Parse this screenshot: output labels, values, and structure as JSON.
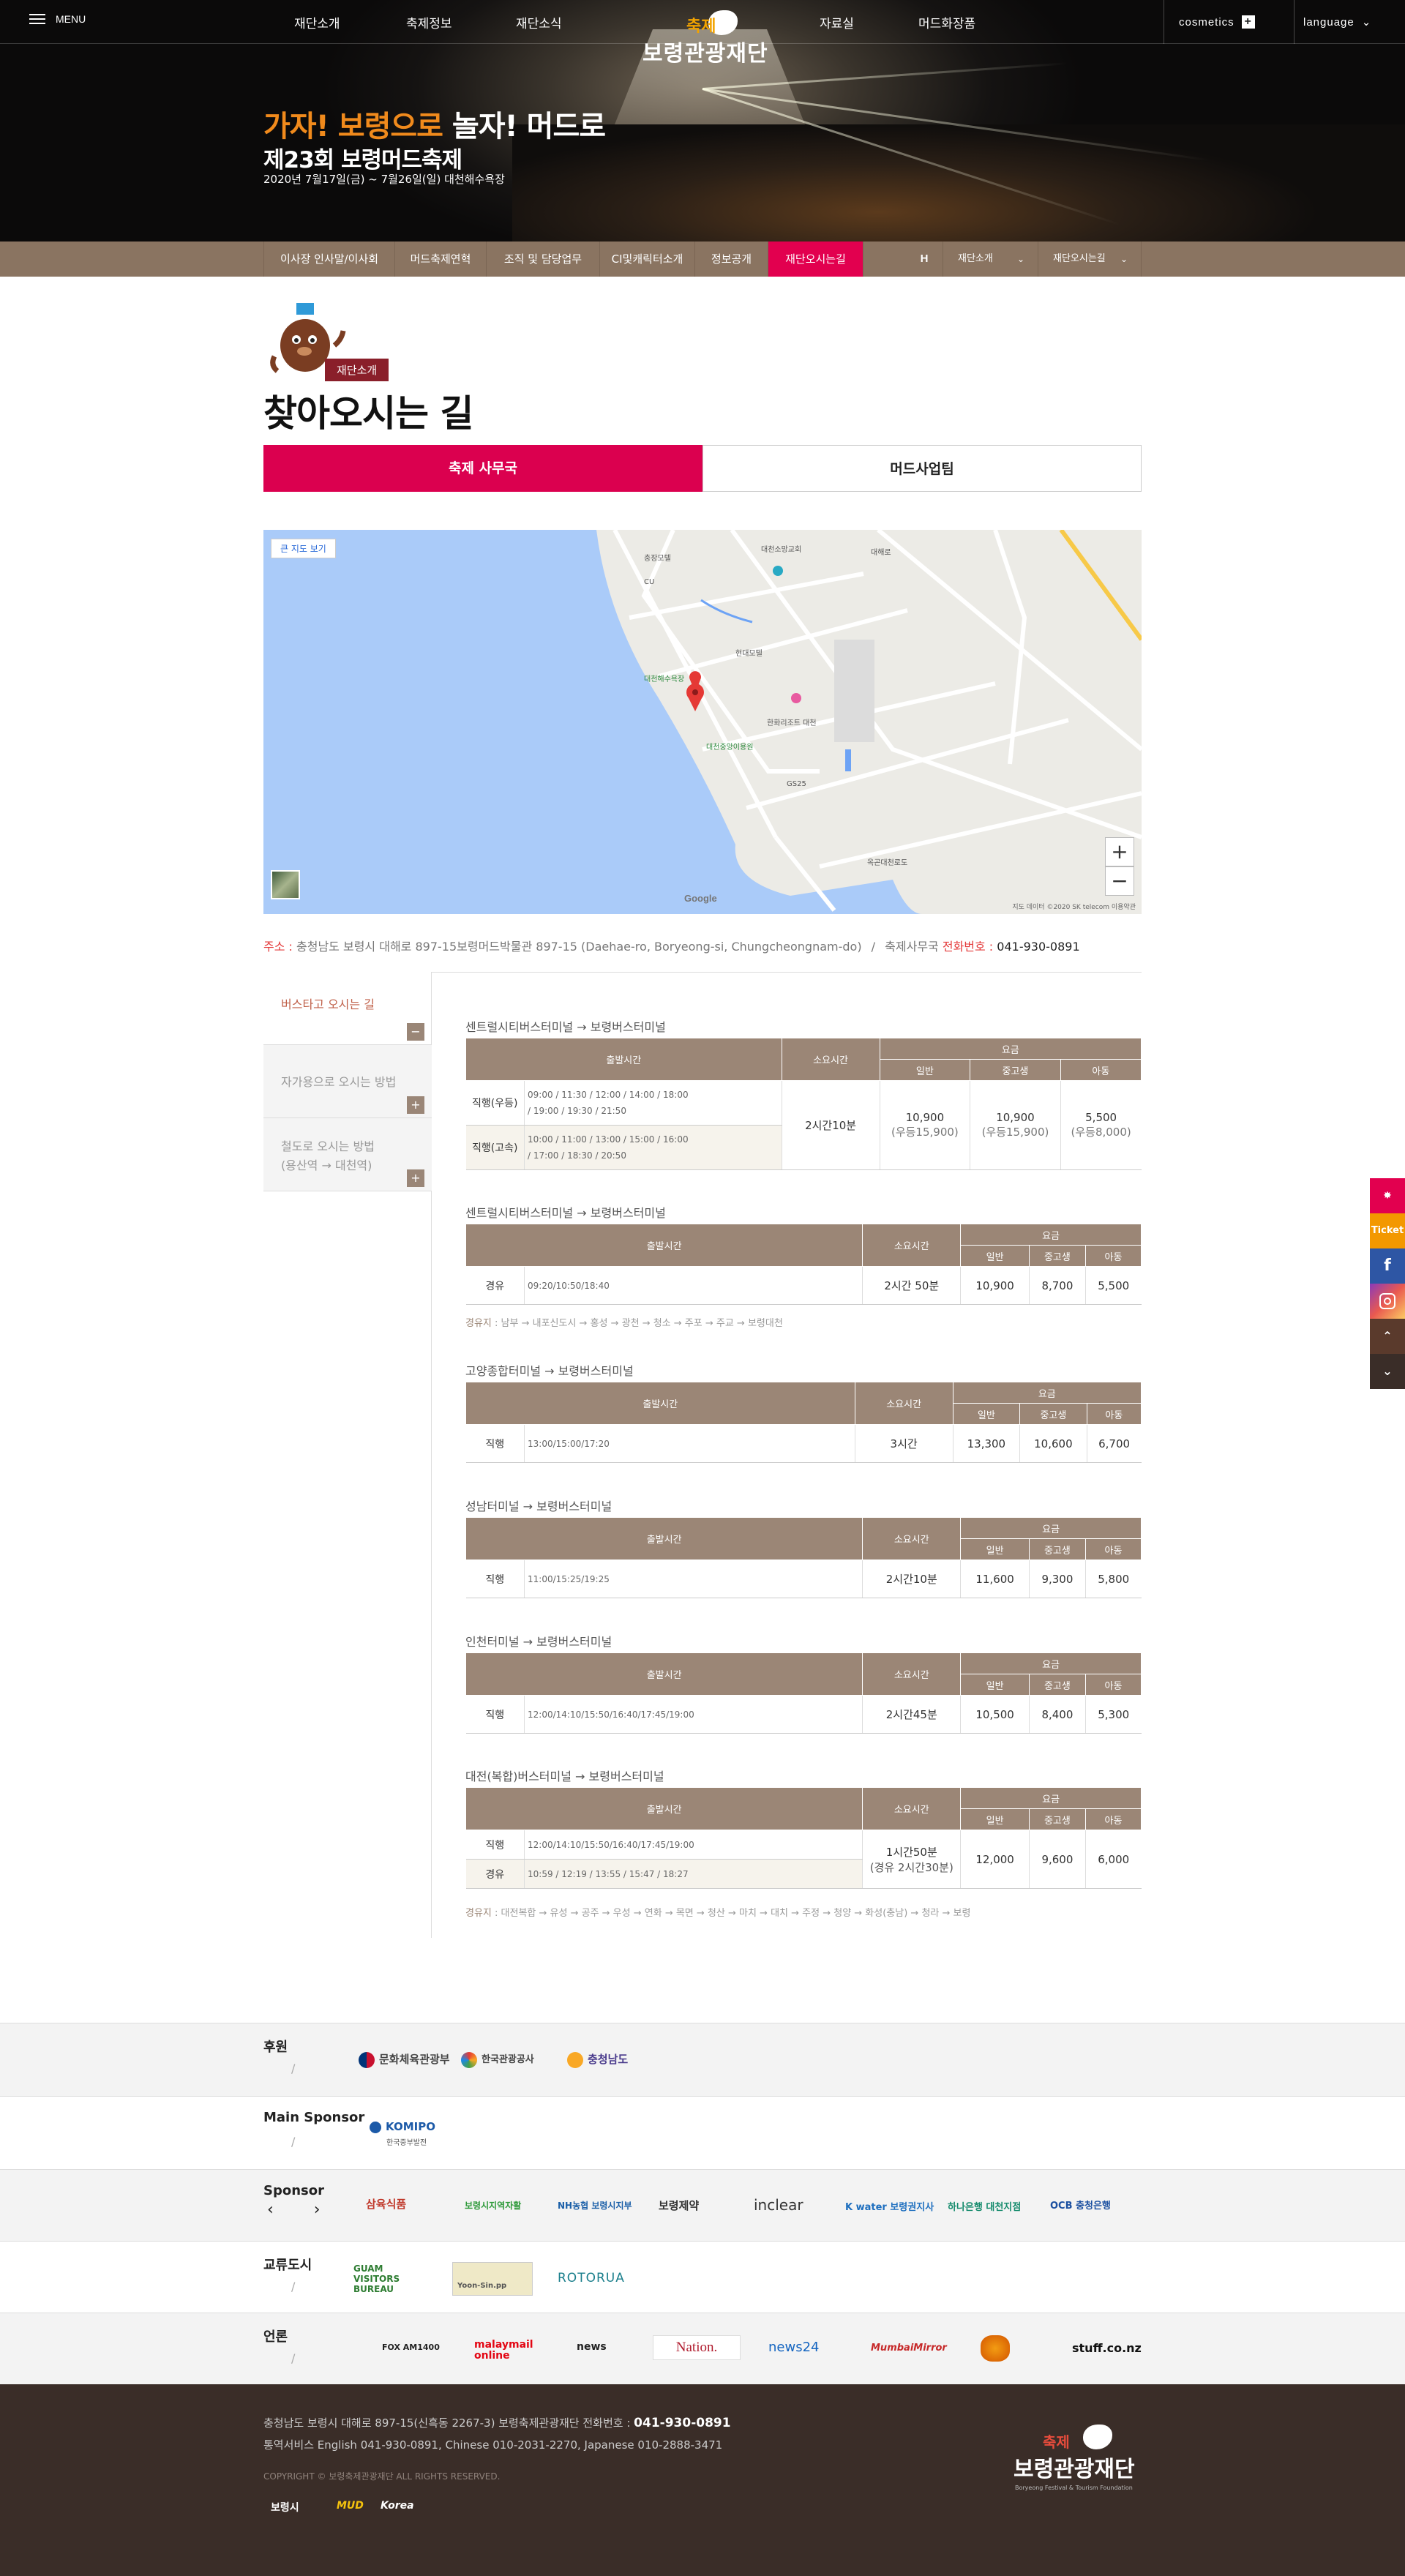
{
  "header": {
    "menu_label": "MENU",
    "gnb_left": [
      "재단소개",
      "축제정보",
      "재단소식"
    ],
    "gnb_right": [
      "자료실",
      "머드화장품"
    ],
    "logo_line1": "축제",
    "logo_line2": "보령관광재단",
    "cosmetics_label": "cosmetics",
    "cosmetics_icon": "+",
    "language_label": "language",
    "language_chevron": "⌄"
  },
  "hero": {
    "line1_a": "가자! 보령으로",
    "line1_b": " 놀자! 머드로",
    "line2": "제23회 보령머드축제",
    "line3": "2020년 7월17일(금) ~ 7월26일(일) 대천해수욕장"
  },
  "subnav": {
    "items": [
      "이사장 인사말/이사회",
      "머드축제연혁",
      "조직 및 담당업무",
      "CI및캐릭터소개",
      "정보공개",
      "재단오시는길"
    ],
    "home_label": "H",
    "drop1": "재단소개",
    "drop2": "재단오시는길",
    "chevron": "⌄"
  },
  "page": {
    "badge": "재단소개",
    "title": "찾아오시는 길",
    "tab_active": "축제 사무국",
    "tab_inactive": "머드사업팀"
  },
  "map": {
    "bigmap_label": "큰 지도 보기",
    "zoom_in": "+",
    "zoom_out": "−",
    "google": "Google",
    "copyright": "지도 데이터 ©2020 SK telecom  이용약관",
    "labels": [
      "대천소망교회",
      "충장모텔",
      "CU",
      "대천해수욕장",
      "현대모텔",
      "한화리조트 대천",
      "대천중앙이용원",
      "GS25",
      "옥곤대천로도",
      "대해로"
    ]
  },
  "address": {
    "label1": "주소 : ",
    "value1": "충청남도 보령시 대해로 897-15보령머드박물관 897-15 (Daehae-ro, Boryeong-si, Chungcheongnam-do)",
    "sep": "/",
    "office": "축제사무국 ",
    "label2": "전화번호 : ",
    "phone": "041-930-0891"
  },
  "lnb": {
    "items": [
      "버스타고 오시는 길",
      "자가용으로 오시는 방법",
      "철도로 오시는 방법",
      "(용산역 → 대천역)"
    ],
    "minus": "−",
    "plus": "+"
  },
  "table_head": {
    "departure": "출발시간",
    "duration": "소요시간",
    "fare": "요금",
    "adult": "일반",
    "teen": "중고생",
    "child": "아동"
  },
  "bus1": {
    "title": "센트럴시티버스터미널 → 보령버스터미널",
    "row1_kind": "직행(우등)",
    "row1_times_a": "09:00 / 11:30 / 12:00 / 14:00 / 18:00",
    "row1_times_b": "/ 19:00 / 19:30 / 21:50",
    "row2_kind": "직행(고속)",
    "row2_times_a": "10:00 / 11:00 / 13:00 / 15:00 / 16:00",
    "row2_times_b": "/ 17:00 / 18:30 / 20:50",
    "duration": "2시간10분",
    "adult": "10,900",
    "adult_sub": "(우등15,900)",
    "teen": "10,900",
    "teen_sub": "(우등15,900)",
    "child": "5,500",
    "child_sub": "(우등8,000)"
  },
  "bus2": {
    "title": "센트럴시티버스터미널 → 보령버스터미널",
    "kind": "경유",
    "times": "09:20/10:50/18:40",
    "duration": "2시간 50분",
    "adult": "10,900",
    "teen": "8,700",
    "child": "5,500",
    "via_label": "경유지",
    "via": " : 남부 → 내포신도시 → 홍성 → 광천 → 청소 → 주포 → 주교 → 보령대천"
  },
  "bus3": {
    "title": "고양종합터미널 → 보령버스터미널",
    "kind": "직행",
    "times": "13:00/15:00/17:20",
    "duration": "3시간",
    "adult": "13,300",
    "teen": "10,600",
    "child": "6,700"
  },
  "bus4": {
    "title": "성남터미널 → 보령버스터미널",
    "kind": "직행",
    "times": "11:00/15:25/19:25",
    "duration": "2시간10분",
    "adult": "11,600",
    "teen": "9,300",
    "child": "5,800"
  },
  "bus5": {
    "title": "인천터미널 → 보령버스터미널",
    "kind": "직행",
    "times": "12:00/14:10/15:50/16:40/17:45/19:00",
    "duration": "2시간45분",
    "adult": "10,500",
    "teen": "8,400",
    "child": "5,300"
  },
  "bus6": {
    "title": "대전(복합)버스터미널 → 보령버스터미널",
    "row1_kind": "직행",
    "row1_times": "12:00/14:10/15:50/16:40/17:45/19:00",
    "row2_kind": "경유",
    "row2_times": "10:59 / 12:19 / 13:55 / 15:47 / 18:27",
    "duration": "1시간50분",
    "duration_sub": "(경유 2시간30분)",
    "adult": "12,000",
    "teen": "9,600",
    "child": "6,000",
    "via_label": "경유지",
    "via": " : 대전복합 → 유성 → 공주 → 우성 → 연화 → 목면 → 청산 → 마치 → 대치 → 주정 → 청양 → 화성(충남) → 청라 → 보령"
  },
  "sponsors": {
    "row1_title": "후원",
    "row1_logos": [
      "문화체육관광부",
      "한국관광공사",
      "충청남도"
    ],
    "row2_title": "Main Sponsor",
    "row2_logos": [
      "KOMIPO"
    ],
    "row2_sub": "한국중부발전",
    "row3_title": "Sponsor",
    "row3_arrows": "‹ ›",
    "row3_logos": [
      "삼육식품",
      "보령시지역자활",
      "NH농협 보령시지부",
      "보령제약",
      "inclear",
      "K water 보령권지사",
      "하나은행 대천지점",
      "OCB 충청은행"
    ],
    "row4_title": "교류도시",
    "row4_logos": [
      "GUAM VISITORS BUREAU",
      "Yoon-Sin.pp",
      "ROTORUA"
    ],
    "row5_title": "언론",
    "row5_logos": [
      "FOX AM1400",
      "malaymail online",
      "news",
      "Nation.",
      "news24",
      "MumbaiMirror",
      "stuff.co.nz"
    ],
    "slash": "/"
  },
  "footer": {
    "line1": "충청남도 보령시 대해로 897-15(신흑동 2267-3) 보령축제관광재단 전화번호 : ",
    "phone": "041-930-0891",
    "line2": "통역서비스 English 041-930-0891, Chinese 010-2031-2270, Japanese 010-2888-3471",
    "copyright": "COPYRIGHT © 보령축제관광재단 ALL RIGHTS RESERVED.",
    "bottom_logos": [
      "보령시",
      "MUD",
      "Korea"
    ],
    "logo_line1": "축제",
    "logo_line2": "보령관광재단",
    "logo_sub": "Boryeong Festival & Tourism Foundation"
  },
  "quick": {
    "ticket": "Ticket",
    "facebook": "f",
    "up": "⌃",
    "down": "⌄"
  },
  "colors": {
    "accent_pink": "#e2004f",
    "brown": "#8a7461",
    "table_head": "#9b8676",
    "footer": "#3a2d28"
  }
}
